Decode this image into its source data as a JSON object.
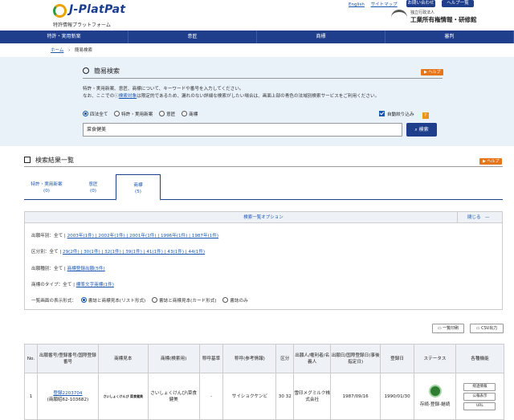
{
  "header": {
    "logo_title": "J-PlatPat",
    "logo_subtitle": "特許情報プラットフォーム",
    "links": [
      "English",
      "サイトマップ"
    ],
    "buttons": [
      "お問い合わせ",
      "ヘルプ一覧"
    ],
    "inpit_small": "独立行政法人",
    "inpit_name": "工業所有権情報・研修館"
  },
  "nav": [
    "特許・実用新案",
    "意匠",
    "商標",
    "審判"
  ],
  "breadcrumb": {
    "home": "ホーム",
    "sep": "›",
    "current": "簡易検索"
  },
  "search": {
    "title": "簡易検索",
    "help": "▶ ヘルプ",
    "desc1": "特許・実用新案、意匠、商標について、キーワードや番号を入力してください。",
    "desc2_pre": "なお、ここでの",
    "desc2_link": "検索対象",
    "desc2_post": "は限定的であるため、漏れのない詳細な検索がしたい場合は、画面上部の青色の法域別検索サービスをご利用ください。",
    "options": [
      "四法全て",
      "特許・実用新案",
      "意匠",
      "商標"
    ],
    "auto_filter": "自動絞り込み",
    "q": "?",
    "value": "菜食健美",
    "button": "検索"
  },
  "results": {
    "title": "検索結果一覧",
    "help": "▶ ヘルプ",
    "tabs": [
      {
        "label": "特許・実用新案",
        "count": "(0)"
      },
      {
        "label": "意匠",
        "count": "(0)"
      },
      {
        "label": "商標",
        "count": "(5)"
      }
    ]
  },
  "options_panel": {
    "header": "検索一覧オプション",
    "close": "閉じる　—",
    "row1_label": "出願年別：全て | ",
    "row1_links": "2003年(1件) | 2002年(1件) | 2001年(1件) | 1996年(1件) | 1987年(1件)",
    "row2_label": "区分別：全て | ",
    "row2_links": "29(2件) | 30(1件) | 32(1件) | 39(1件) | 41(1件) | 43(1件) | 44(1件)",
    "row3_label": "出願種別：全て | ",
    "row3_links": "商標登録出願(5件)",
    "row4_label": "商標のタイプ：全て | ",
    "row4_links": "標準文字商標(1件)",
    "display_label": "一覧画面の表示形式：",
    "display_opts": [
      "書誌と商標見本(リスト形式)",
      "書誌と商標見本(カード形式)",
      "書誌のみ"
    ]
  },
  "toolbar": {
    "print": "一覧印刷",
    "csv": "CSV出力"
  },
  "table": {
    "headers": [
      "No.",
      "出願番号/登録番号/国際登録番号",
      "商標見本",
      "商標(検索用)",
      "称呼基準",
      "称呼(参考情報)",
      "区分",
      "出願人/権利者/名義人",
      "出願日/国際登録日(事後指定日)",
      "登録日",
      "ステータス",
      "各種機能"
    ],
    "row": {
      "no": "1",
      "reg": "登録2203704",
      "app": "(商願昭62-103682)",
      "sample": "さいしょくけんび 菜食健美",
      "search_name": "さいしょくけんび\\菜食健美",
      "kijun": "-",
      "shoko": "サイショクケンビ",
      "kubun": "30 32",
      "applicant": "雪印メグミルク株式会社",
      "app_date": "1987/09/16",
      "reg_date": "1990/01/30",
      "status": "存続-登録-継続",
      "funcs": [
        "経過情報",
        "公報表示",
        "URL"
      ]
    }
  }
}
